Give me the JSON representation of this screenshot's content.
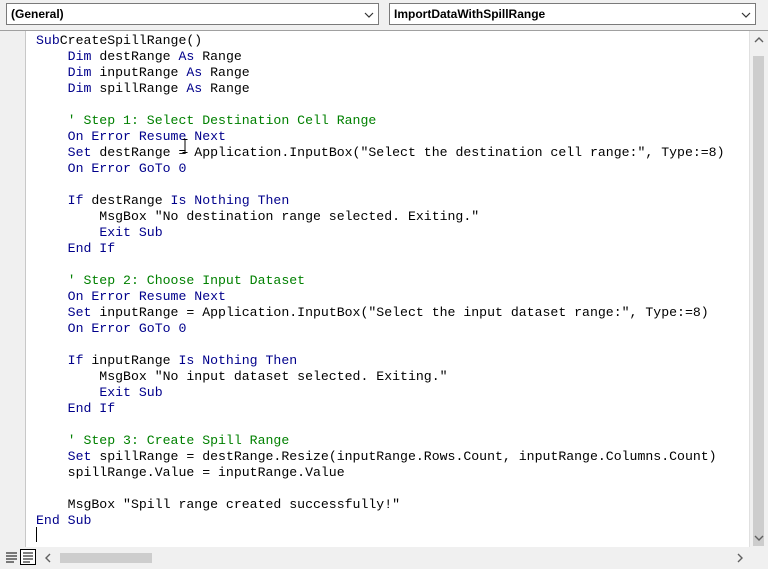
{
  "object_combo": {
    "value": "(General)"
  },
  "procedure_combo": {
    "value": "ImportDataWithSpillRange"
  },
  "code_lines": [
    [
      [
        "kw",
        "Sub"
      ],
      [
        "",
        "CreateSpillRange()"
      ]
    ],
    [
      [
        "",
        "    "
      ],
      [
        "kw",
        "Dim"
      ],
      [
        "",
        " destRange "
      ],
      [
        "kw",
        "As"
      ],
      [
        "",
        " Range"
      ]
    ],
    [
      [
        "",
        "    "
      ],
      [
        "kw",
        "Dim"
      ],
      [
        "",
        " inputRange "
      ],
      [
        "kw",
        "As"
      ],
      [
        "",
        " Range"
      ]
    ],
    [
      [
        "",
        "    "
      ],
      [
        "kw",
        "Dim"
      ],
      [
        "",
        " spillRange "
      ],
      [
        "kw",
        "As"
      ],
      [
        "",
        " Range"
      ]
    ],
    [],
    [
      [
        "cm",
        "    ' Step 1: Select Destination Cell Range"
      ]
    ],
    [
      [
        "",
        "    "
      ],
      [
        "kw",
        "On Error Resume Next"
      ]
    ],
    [
      [
        "",
        "    "
      ],
      [
        "kw",
        "Set"
      ],
      [
        "",
        " destRange = Application.InputBox(\"Select the destination cell range:\", Type:=8)"
      ]
    ],
    [
      [
        "",
        "    "
      ],
      [
        "kw",
        "On Error GoTo 0"
      ]
    ],
    [],
    [
      [
        "",
        "    "
      ],
      [
        "kw",
        "If"
      ],
      [
        "",
        " destRange "
      ],
      [
        "kw",
        "Is Nothing Then"
      ]
    ],
    [
      [
        "",
        "        MsgBox \"No destination range selected. Exiting.\""
      ]
    ],
    [
      [
        "",
        "        "
      ],
      [
        "kw",
        "Exit Sub"
      ]
    ],
    [
      [
        "",
        "    "
      ],
      [
        "kw",
        "End If"
      ]
    ],
    [],
    [
      [
        "cm",
        "    ' Step 2: Choose Input Dataset"
      ]
    ],
    [
      [
        "",
        "    "
      ],
      [
        "kw",
        "On Error Resume Next"
      ]
    ],
    [
      [
        "",
        "    "
      ],
      [
        "kw",
        "Set"
      ],
      [
        "",
        " inputRange = Application.InputBox(\"Select the input dataset range:\", Type:=8)"
      ]
    ],
    [
      [
        "",
        "    "
      ],
      [
        "kw",
        "On Error GoTo 0"
      ]
    ],
    [],
    [
      [
        "",
        "    "
      ],
      [
        "kw",
        "If"
      ],
      [
        "",
        " inputRange "
      ],
      [
        "kw",
        "Is Nothing Then"
      ]
    ],
    [
      [
        "",
        "        MsgBox \"No input dataset selected. Exiting.\""
      ]
    ],
    [
      [
        "",
        "        "
      ],
      [
        "kw",
        "Exit Sub"
      ]
    ],
    [
      [
        "",
        "    "
      ],
      [
        "kw",
        "End If"
      ]
    ],
    [],
    [
      [
        "cm",
        "    ' Step 3: Create Spill Range"
      ]
    ],
    [
      [
        "",
        "    "
      ],
      [
        "kw",
        "Set"
      ],
      [
        "",
        " spillRange = destRange.Resize(inputRange.Rows.Count, inputRange.Columns.Count)"
      ]
    ],
    [
      [
        "",
        "    spillRange.Value = inputRange.Value"
      ]
    ],
    [],
    [
      [
        "",
        "    MsgBox \"Spill range created successfully!\""
      ]
    ],
    [
      [
        "kw",
        "End Sub"
      ]
    ],
    []
  ],
  "colors": {
    "keyword": "#00008b",
    "comment": "#008000",
    "text": "#000000"
  },
  "icons": [
    "dropdown-arrow-icon",
    "procedure-view-icon",
    "full-module-view-icon",
    "scroll-up-icon",
    "scroll-down-icon",
    "scroll-left-icon",
    "scroll-right-icon",
    "ibeam-cursor-icon"
  ]
}
